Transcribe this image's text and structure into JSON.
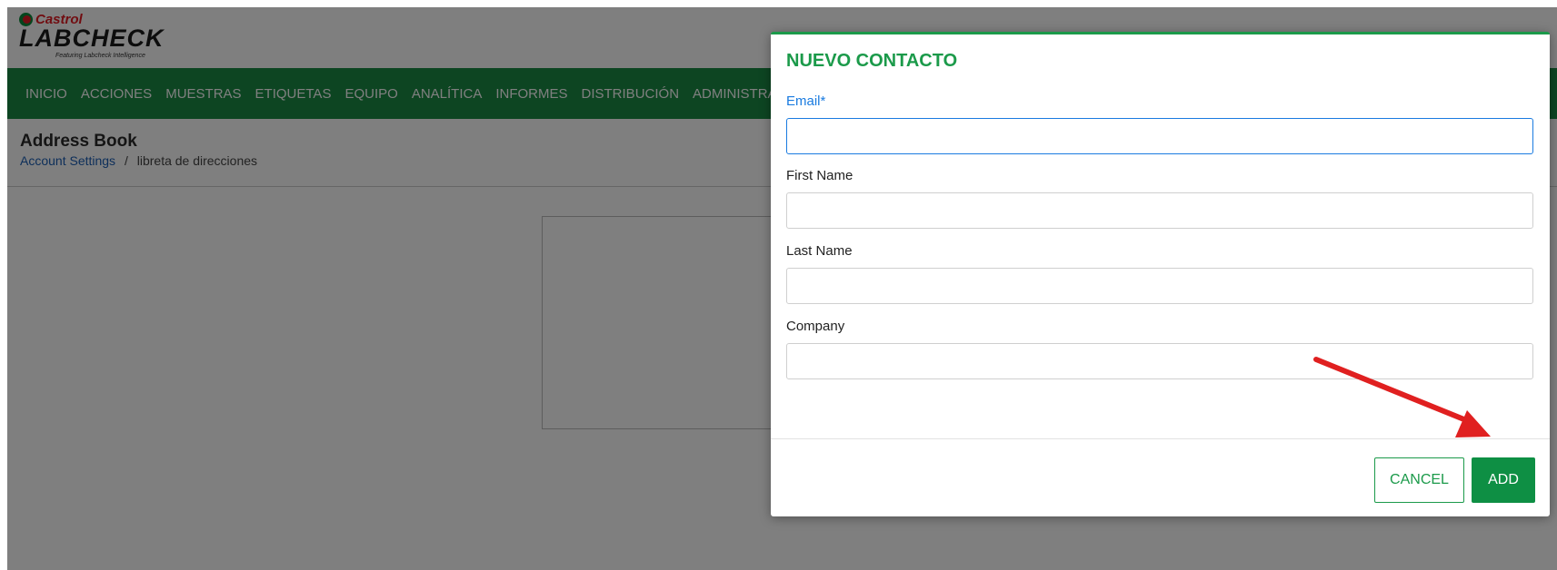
{
  "logo": {
    "brand": "Castrol",
    "product": "LABCHECK",
    "tagline": "Featuring Labcheck Intelligence"
  },
  "nav": {
    "items": [
      {
        "label": "INICIO"
      },
      {
        "label": "ACCIONES"
      },
      {
        "label": "MUESTRAS"
      },
      {
        "label": "ETIQUETAS"
      },
      {
        "label": "EQUIPO"
      },
      {
        "label": "ANALÍTICA"
      },
      {
        "label": "INFORMES"
      },
      {
        "label": "DISTRIBUCIÓN"
      },
      {
        "label": "ADMINISTRACIÓN"
      }
    ]
  },
  "page": {
    "title": "Address Book",
    "breadcrumb": {
      "link": "Account Settings",
      "separator": "/",
      "current": "libreta de direcciones"
    }
  },
  "modal": {
    "title": "NUEVO CONTACTO",
    "fields": {
      "email": {
        "label": "Email*",
        "value": "",
        "placeholder": ""
      },
      "first_name": {
        "label": "First Name",
        "value": "",
        "placeholder": ""
      },
      "last_name": {
        "label": "Last Name",
        "value": "",
        "placeholder": ""
      },
      "company": {
        "label": "Company",
        "value": "",
        "placeholder": ""
      }
    },
    "buttons": {
      "cancel": "CANCEL",
      "add": "ADD"
    }
  },
  "annotation": {
    "arrow_color": "#e02020",
    "arrow_target": "add-button"
  },
  "colors": {
    "brand_green": "#1b8a45",
    "accent_green": "#1b9a4a",
    "focus_blue": "#1a7be0",
    "castrol_red": "#e31b23"
  }
}
